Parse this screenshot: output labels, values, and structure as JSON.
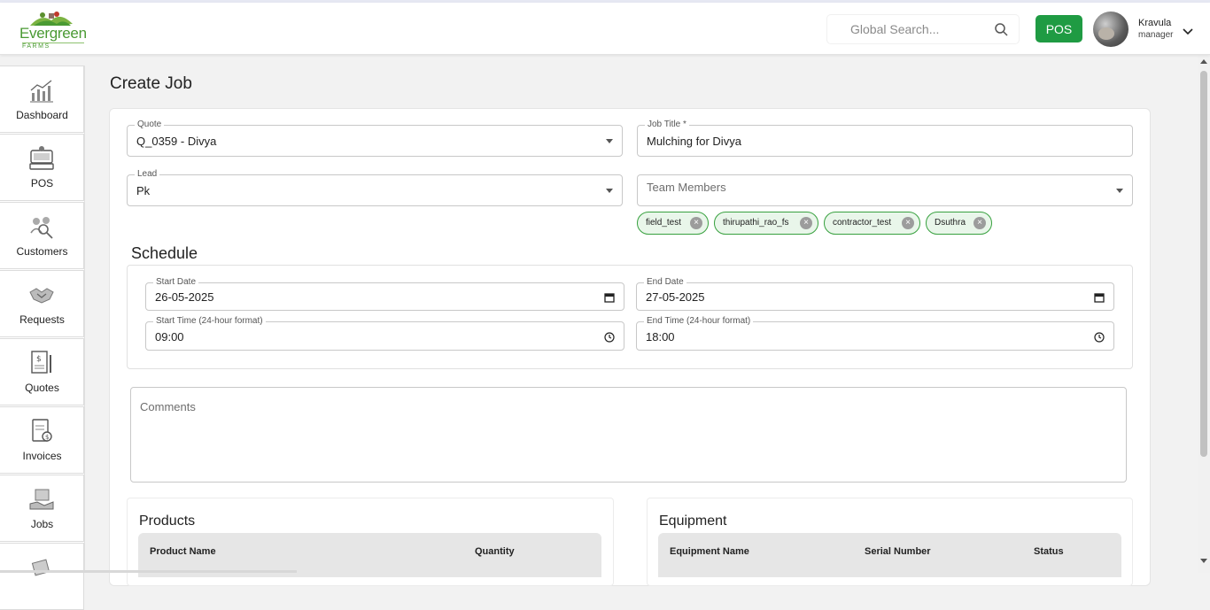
{
  "header": {
    "brand": "Evergreen",
    "brand_sub": "FARMS",
    "search_placeholder": "Global Search...",
    "pos_label": "POS",
    "user_name": "Kravula",
    "user_role": "manager"
  },
  "sidebar": {
    "items": [
      {
        "label": "Dashboard",
        "icon": "chart-icon"
      },
      {
        "label": "POS",
        "icon": "pos-terminal-icon"
      },
      {
        "label": "Customers",
        "icon": "customers-icon"
      },
      {
        "label": "Requests",
        "icon": "handshake-icon"
      },
      {
        "label": "Quotes",
        "icon": "quote-document-icon"
      },
      {
        "label": "Invoices",
        "icon": "invoice-icon"
      },
      {
        "label": "Jobs",
        "icon": "jobs-icon"
      }
    ]
  },
  "page": {
    "title": "Create Job"
  },
  "form": {
    "quote": {
      "label": "Quote",
      "value": "Q_0359 - Divya"
    },
    "job_title": {
      "label": "Job Title *",
      "value": "Mulching for Divya"
    },
    "lead": {
      "label": "Lead",
      "value": "Pk"
    },
    "team_members": {
      "placeholder": "Team Members",
      "chips": [
        "field_test",
        "thirupathi_rao_fs",
        "contractor_test",
        "Dsuthra"
      ]
    }
  },
  "schedule": {
    "title": "Schedule",
    "start_date": {
      "label": "Start Date",
      "value": "26-05-2025"
    },
    "end_date": {
      "label": "End Date",
      "value": "27-05-2025"
    },
    "start_time": {
      "label": "Start Time (24-hour format)",
      "value": "09:00"
    },
    "end_time": {
      "label": "End Time (24-hour format)",
      "value": "18:00"
    }
  },
  "comments": {
    "placeholder": "Comments"
  },
  "products": {
    "title": "Products",
    "columns": [
      "Product Name",
      "Quantity"
    ]
  },
  "equipment": {
    "title": "Equipment",
    "columns": [
      "Equipment Name",
      "Serial Number",
      "Status"
    ]
  },
  "colors": {
    "accent": "#1f9b43",
    "chip_bg": "#e9f6ea",
    "chip_border": "#38a13f"
  }
}
